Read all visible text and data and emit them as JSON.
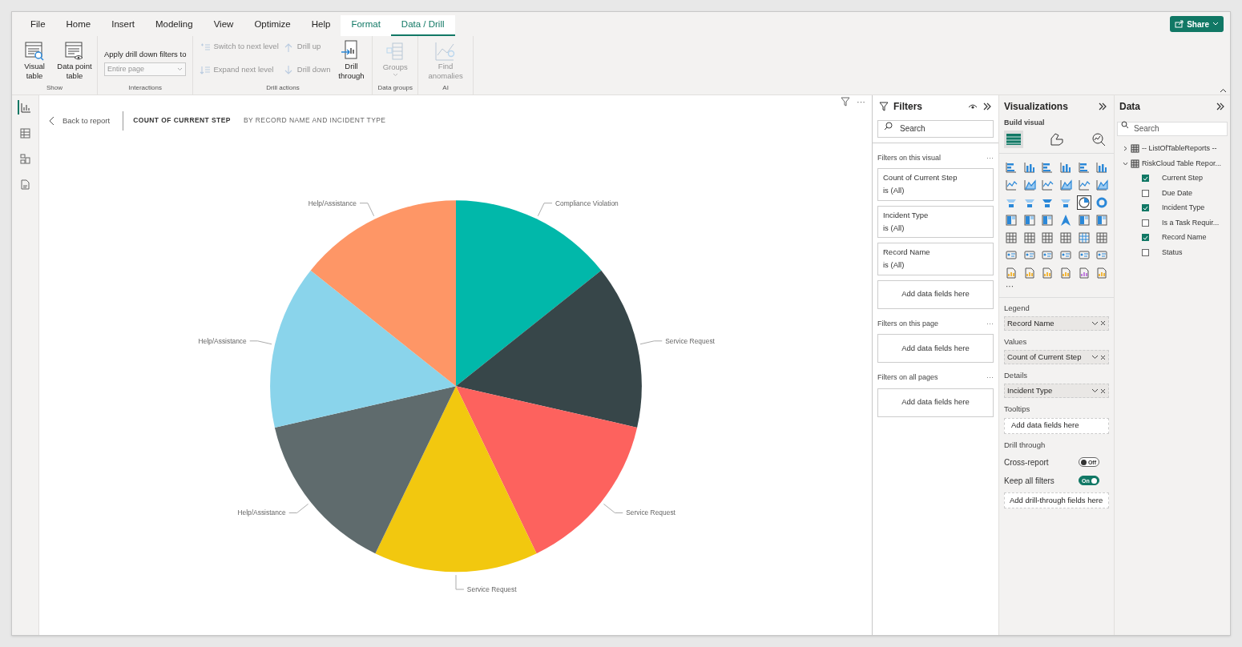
{
  "ribbon_tabs": [
    {
      "label": "File",
      "selected": false,
      "contextual": false
    },
    {
      "label": "Home",
      "selected": false,
      "contextual": false
    },
    {
      "label": "Insert",
      "selected": false,
      "contextual": false
    },
    {
      "label": "Modeling",
      "selected": false,
      "contextual": false
    },
    {
      "label": "View",
      "selected": false,
      "contextual": false
    },
    {
      "label": "Optimize",
      "selected": false,
      "contextual": false
    },
    {
      "label": "Help",
      "selected": false,
      "contextual": false
    },
    {
      "label": "Format",
      "selected": false,
      "contextual": true
    },
    {
      "label": "Data / Drill",
      "selected": true,
      "contextual": true
    }
  ],
  "share_button": "Share",
  "ribbon": {
    "show": {
      "label": "Show",
      "buttons": [
        {
          "label": "Visual table",
          "kind": "table-search"
        },
        {
          "label": "Data point table",
          "kind": "table-eye"
        }
      ]
    },
    "interactions": {
      "label": "Interactions",
      "caption": "Apply drill down filters to",
      "dropdown": {
        "value": "Entire page",
        "disabled": true
      }
    },
    "drill_actions": {
      "label": "Drill actions",
      "items": [
        {
          "label": "Switch to next level",
          "disabled": true
        },
        {
          "label": "Expand next level",
          "disabled": true
        },
        {
          "label": "Drill up",
          "disabled": true
        },
        {
          "label": "Drill down",
          "disabled": true
        }
      ],
      "drill_through": {
        "label": "Drill through",
        "disabled": false
      }
    },
    "data_groups": {
      "label": "Data groups",
      "button": {
        "label": "Groups",
        "disabled": true
      }
    },
    "ai": {
      "label": "AI",
      "button": {
        "label": "Find anomalies",
        "disabled": true
      }
    }
  },
  "left_nav": [
    {
      "kind": "report",
      "selected": true
    },
    {
      "kind": "table",
      "selected": false
    },
    {
      "kind": "model",
      "selected": false
    },
    {
      "kind": "dax",
      "selected": false
    }
  ],
  "canvas": {
    "back": "Back to report",
    "title": "COUNT OF CURRENT STEP",
    "subtitle": "BY RECORD NAME AND INCIDENT TYPE",
    "more": "···",
    "pie_slices": [
      {
        "label": "Compliance Violation",
        "color": "#01b8aa"
      },
      {
        "label": "Service Request",
        "color": "#374649"
      },
      {
        "label": "Service Request",
        "color": "#fd625e"
      },
      {
        "label": "Service Request",
        "color": "#f2c80f"
      },
      {
        "label": "Help/Assistance",
        "color": "#5f6b6d"
      },
      {
        "label": "Help/Assistance",
        "color": "#8ad4eb"
      },
      {
        "label": "Help/Assistance",
        "color": "#fe9666"
      }
    ]
  },
  "filters": {
    "title": "Filters",
    "search_placeholder": "Search",
    "sections": [
      {
        "title": "Filters on this visual",
        "more": "···",
        "cards": [
          {
            "name": "Count of Current Step",
            "state": "is (All)"
          },
          {
            "name": "Incident Type",
            "state": "is (All)"
          },
          {
            "name": "Record Name",
            "state": "is (All)"
          }
        ],
        "add": "Add data fields here"
      },
      {
        "title": "Filters on this page",
        "more": "···",
        "add": "Add data fields here"
      },
      {
        "title": "Filters on all pages",
        "more": "···",
        "add": "Add data fields here"
      }
    ]
  },
  "visualizations": {
    "title": "Visualizations",
    "build_visual": "Build visual",
    "modes": [
      {
        "kind": "build",
        "selected": true
      },
      {
        "kind": "format",
        "selected": false
      },
      {
        "kind": "analytics",
        "selected": false
      }
    ],
    "gallery": [
      {
        "selected": false
      },
      {
        "selected": false
      },
      {
        "selected": false
      },
      {
        "selected": false
      },
      {
        "selected": false
      },
      {
        "selected": false
      },
      {
        "selected": false
      },
      {
        "selected": false
      },
      {
        "selected": false
      },
      {
        "selected": false
      },
      {
        "selected": false
      },
      {
        "selected": false
      },
      {
        "selected": false
      },
      {
        "selected": false
      },
      {
        "selected": false
      },
      {
        "selected": false
      },
      {
        "selected": true
      },
      {
        "selected": false
      },
      {
        "selected": false
      },
      {
        "selected": false
      },
      {
        "selected": false
      },
      {
        "selected": false
      },
      {
        "selected": false
      },
      {
        "selected": false
      },
      {
        "selected": false
      },
      {
        "selected": false
      },
      {
        "selected": false
      },
      {
        "selected": false
      },
      {
        "selected": false
      },
      {
        "selected": false
      },
      {
        "selected": false
      },
      {
        "selected": false
      },
      {
        "selected": false
      },
      {
        "selected": false
      },
      {
        "selected": false
      },
      {
        "selected": false
      },
      {
        "selected": false
      },
      {
        "selected": false
      },
      {
        "selected": false
      },
      {
        "selected": false
      },
      {
        "selected": false
      },
      {
        "selected": false
      }
    ],
    "more": "···",
    "wells": [
      {
        "label": "Legend",
        "field": "Record Name"
      },
      {
        "label": "Values",
        "field": "Count of Current Step"
      },
      {
        "label": "Details",
        "field": "Incident Type"
      },
      {
        "label": "Tooltips",
        "placeholder": "Add data fields here"
      }
    ],
    "drill_through": {
      "label": "Drill through",
      "toggles": [
        {
          "label": "Cross-report",
          "on": false,
          "state": "Off"
        },
        {
          "label": "Keep all filters",
          "on": true,
          "state": "On"
        }
      ],
      "add": "Add drill-through fields here"
    }
  },
  "data": {
    "title": "Data",
    "search_placeholder": "Search",
    "tables": [
      {
        "name": "-- ListOfTableReports --",
        "expanded": false
      },
      {
        "name": "RiskCloud Table Repor...",
        "expanded": true,
        "children": [
          {
            "name": "Current Step",
            "checked": true
          },
          {
            "name": "Due Date",
            "checked": false
          },
          {
            "name": "Incident Type",
            "checked": true
          },
          {
            "name": "Is a Task Requir...",
            "checked": false
          },
          {
            "name": "Record Name",
            "checked": true
          },
          {
            "name": "Status",
            "checked": false
          }
        ]
      }
    ]
  }
}
